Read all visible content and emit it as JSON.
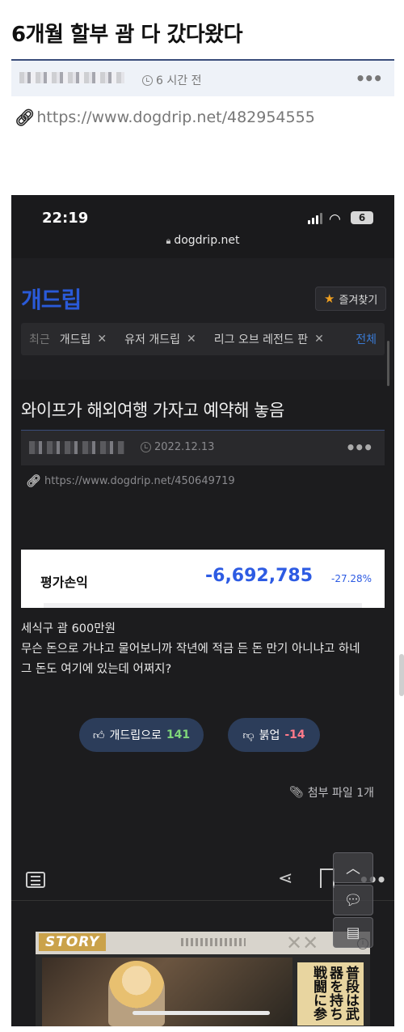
{
  "post": {
    "title": "6개월 할부 괌 다 갔다왔다",
    "time": "6 시간 전",
    "more": "•••",
    "link": "https://www.dogdrip.net/482954555"
  },
  "phone": {
    "status_time": "22:19",
    "battery": "6",
    "url": "dogdrip.net",
    "site_logo": "개드립",
    "bookmark": "즐겨찾기",
    "tabs": {
      "recent": "최근",
      "items": [
        "개드립",
        "유저 개드립",
        "리그 오브 레전드 판"
      ],
      "close": "✕",
      "all": "전체"
    },
    "article": {
      "title": "와이프가 해외여행 가자고 예약해 놓음",
      "date": "2022.12.13",
      "more": "•••",
      "link": "https://www.dogdrip.net/450649719"
    },
    "pl_card": {
      "label": "평가손익",
      "value": "-6,692,785",
      "percent": "-27.28%"
    },
    "body": [
      "세식구 괌 600만원",
      "무슨 돈으로 가냐고 물어보니까 작년에 적금 든 돈 만기 아니냐고 하네",
      "그 돈도 여기에 있는데 어쩌지?"
    ],
    "vote_up": {
      "label": "개드립으로",
      "count": "141"
    },
    "vote_down": {
      "label": "붉업",
      "count": "-14"
    },
    "attachment": "첨부 파일 1개",
    "toolbar_more": "•••",
    "ad": {
      "story": "STORY",
      "cjk": "普段は武器を持ち戦闘に参"
    }
  },
  "colors": {
    "accent_blue": "#2d5be3",
    "logo_blue": "#2a5ad8",
    "upvote_green": "#7fd67a",
    "downvote_red": "#ff7a8a"
  }
}
